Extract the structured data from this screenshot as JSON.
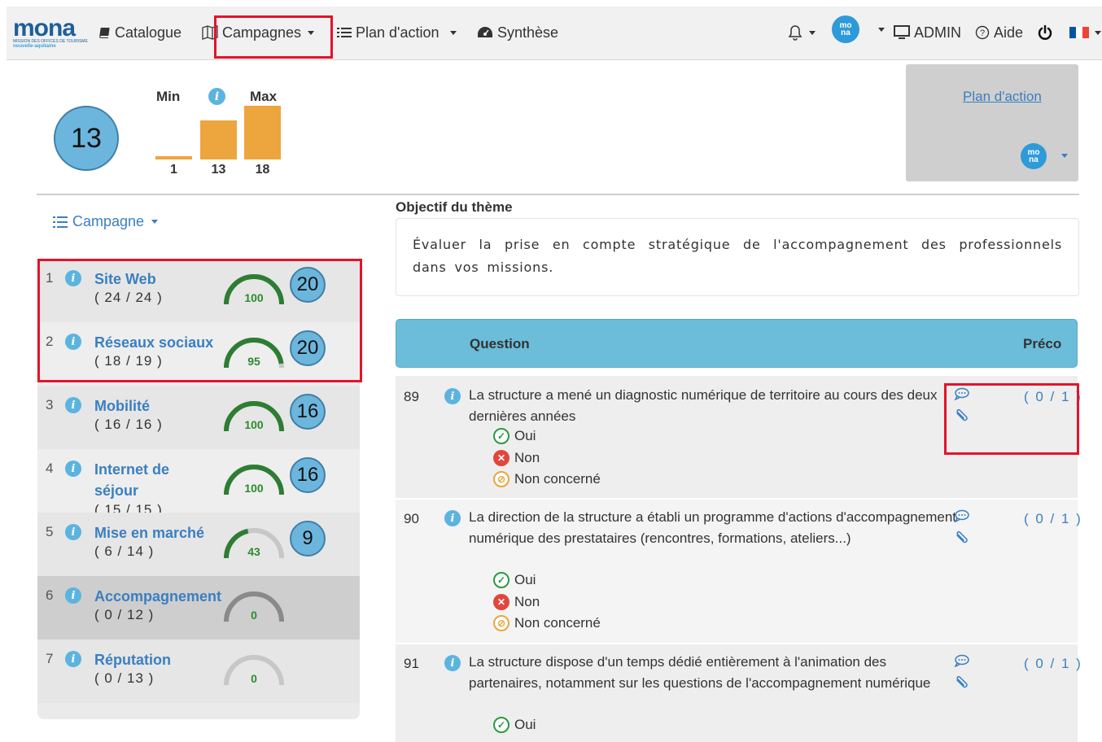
{
  "nav": {
    "logo": {
      "word": "mona",
      "tagline": "MISSION DES OFFICES DE TOURISME",
      "region": "nouvelle-aquitaine"
    },
    "catalogue": "Catalogue",
    "campagnes": "Campagnes",
    "plan_action": "Plan d'action",
    "synthese": "Synthèse",
    "admin": "ADMIN",
    "aide": "Aide"
  },
  "summary": {
    "score": "13",
    "min_label": "Min",
    "max_label": "Max",
    "info_glyph": "i",
    "bars": [
      {
        "value": 1,
        "label": "1"
      },
      {
        "value": 13,
        "label": "13"
      },
      {
        "value": 18,
        "label": "18"
      }
    ],
    "plan_action_link": "Plan d'action"
  },
  "campaign_menu": "Campagne",
  "themes": [
    {
      "num": "1",
      "title": "Site Web",
      "count": "( 24 / 24 )",
      "percent": 100,
      "percent_label": "100",
      "score": "20"
    },
    {
      "num": "2",
      "title": "Réseaux sociaux",
      "count": "( 18 / 19 )",
      "percent": 95,
      "percent_label": "95",
      "score": "20"
    },
    {
      "num": "3",
      "title": "Mobilité",
      "count": "( 16 / 16 )",
      "percent": 100,
      "percent_label": "100",
      "score": "16"
    },
    {
      "num": "4",
      "title": "Internet de séjour",
      "title_line1": "Internet de",
      "title_line2": "séjour",
      "count": "( 15 / 15 )",
      "percent": 100,
      "percent_label": "100",
      "score": "16"
    },
    {
      "num": "5",
      "title": "Mise en marché",
      "count": "( 6 / 14 )",
      "percent": 43,
      "percent_label": "43",
      "score": "9"
    },
    {
      "num": "6",
      "title": "Accompagnement",
      "count": "( 0 / 12 )",
      "percent": 0,
      "percent_label": "0",
      "score": ""
    },
    {
      "num": "7",
      "title": "Réputation",
      "count": "( 0 / 13 )",
      "percent": 0,
      "percent_label": "0",
      "score": ""
    }
  ],
  "objectif": {
    "title": "Objectif du thème",
    "text": "Évaluer la prise en compte stratégique de l'accompagnement des professionnels dans vos missions."
  },
  "table": {
    "col_question": "Question",
    "col_preco": "Préco"
  },
  "questions": [
    {
      "num": "89",
      "text": "La structure a mené un diagnostic numérique de territoire au cours des deux dernières années",
      "preco": "( 0 / 1 )"
    },
    {
      "num": "90",
      "text": "La direction de la structure a établi un programme d'actions d'accompagnement numérique des prestataires (rencontres, formations, ateliers...)",
      "preco": "( 0 / 1 )"
    },
    {
      "num": "91",
      "text": "La structure dispose d'un temps dédié entièrement à l'animation des partenaires, notamment sur les questions de l'accompagnement numérique",
      "preco": "( 0 / 1 )"
    }
  ],
  "options": {
    "oui": "Oui",
    "non": "Non",
    "nc": "Non concerné"
  },
  "colors": {
    "accent": "#3a7fc1",
    "badge": "#6cb6dd",
    "bar": "#eda53d",
    "gauge_green": "#2e7d32",
    "highlight": "#e5122a"
  },
  "flag": {
    "colors": [
      "#0055a4",
      "#ffffff",
      "#ef4135"
    ]
  }
}
